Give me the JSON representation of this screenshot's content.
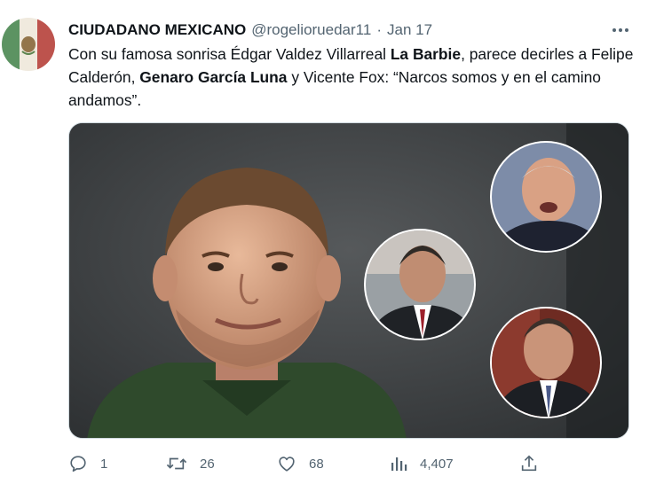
{
  "tweet": {
    "author": {
      "display_name": "CIUDADANO MEXICANO",
      "handle": "@rogelioruedar11",
      "separator": "·",
      "date": "Jan 17"
    },
    "text": {
      "part1": "Con su famosa sonrisa Édgar Valdez Villarreal ",
      "bold1": "La Barbie",
      "part2": ", parece decirles a Felipe Calderón, ",
      "bold2": "Genaro García Luna",
      "part3": " y Vicente Fox: “Narcos somos y en el camino andamos”."
    },
    "stats": {
      "replies": "1",
      "retweets": "26",
      "likes": "68",
      "views": "4,407"
    }
  },
  "colors": {
    "text": "#0f1419",
    "secondary": "#536471",
    "border": "#cfd9de",
    "flag_green": "#2e7d32",
    "flag_red": "#c62828"
  },
  "icons": {
    "avatar": "mexican-flag-avatar",
    "more": "more-horizontal-icon",
    "reply": "reply-icon",
    "retweet": "retweet-icon",
    "like": "heart-icon",
    "views": "views-chart-icon",
    "share": "share-icon"
  }
}
